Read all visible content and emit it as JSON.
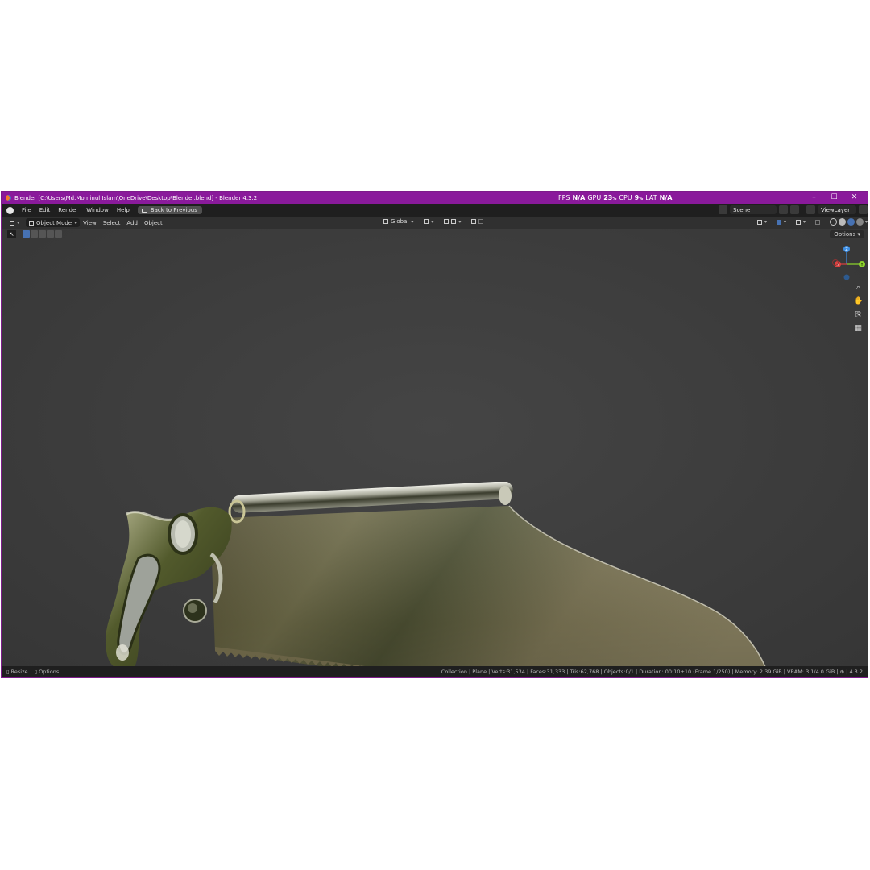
{
  "window": {
    "title": "Blender [C:\\Users\\Md.Mominul Islam\\OneDrive\\Desktop\\Blender.blend] - Blender 4.3.2",
    "perf": {
      "fps_label": "FPS",
      "fps_value": "N/A",
      "gpu_label": "GPU",
      "gpu_value": "23",
      "cpu_label": "CPU",
      "cpu_value": "9",
      "lat_label": "LAT",
      "lat_value": "N/A",
      "percent": "%"
    },
    "controls": {
      "minimize": "–",
      "maximize": "☐",
      "close": "✕"
    }
  },
  "menubar": {
    "items": [
      "File",
      "Edit",
      "Render",
      "Window",
      "Help"
    ],
    "back_button": "Back to Previous",
    "scene": "Scene",
    "view_layer": "ViewLayer"
  },
  "header": {
    "mode": "Object Mode",
    "menus": [
      "View",
      "Select",
      "Add",
      "Object"
    ],
    "transform_orientation": "Global",
    "options": "Options"
  },
  "gizmo": {
    "z": "Z",
    "y": "Y",
    "x": "X"
  },
  "statusbar": {
    "resize": "Resize",
    "options": "Options",
    "stats": "Collection | Plane | Verts:31,534 | Faces:31,333 | Tris:62,768 | Objects:0/1 | Duration: 00:10+10 (Frame 1/250) | Memory: 2.39 GiB | VRAM: 3.1/4.0 GiB |",
    "version": "4.3.2"
  },
  "colors": {
    "titlebar": "#8a1a9b",
    "axis_x": "#e0403f",
    "axis_y": "#8bd12b",
    "axis_z": "#3d8fe6",
    "selection": "#4772b3"
  }
}
